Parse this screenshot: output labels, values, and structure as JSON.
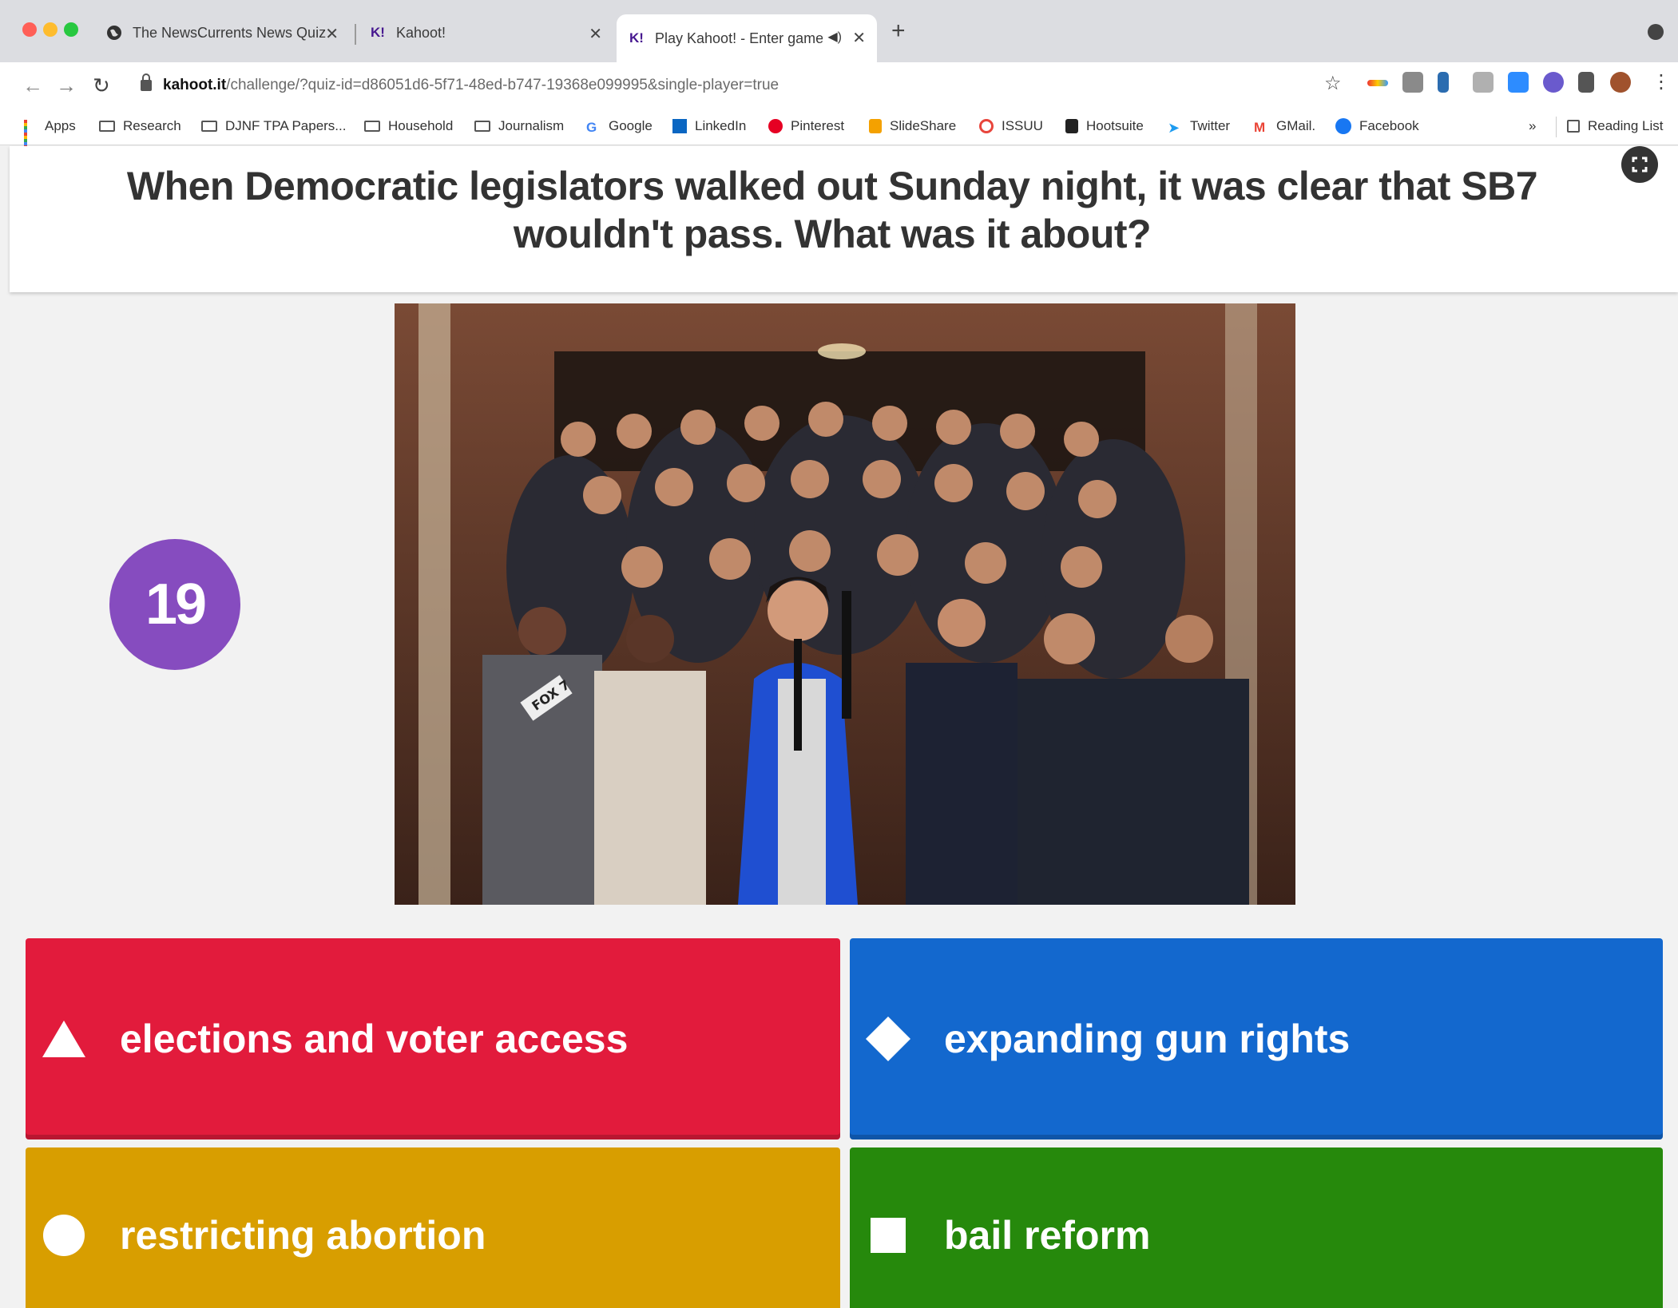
{
  "browser": {
    "tabs": [
      {
        "title": "The NewsCurrents News Quiz",
        "favicon": "globe-icon"
      },
      {
        "title": "Kahoot!",
        "favicon": "K!"
      },
      {
        "title": "Play Kahoot! - Enter game",
        "favicon": "K!"
      }
    ],
    "url_host": "kahoot.it",
    "url_path": "/challenge/?quiz-id=d86051d6-5f71-48ed-b747-19368e099995&single-player=true",
    "bookmarks": [
      {
        "label": "Apps",
        "icon": "apps-grid-icon"
      },
      {
        "label": "Research",
        "icon": "folder-icon"
      },
      {
        "label": "DJNF TPA Papers...",
        "icon": "folder-icon"
      },
      {
        "label": "Household",
        "icon": "folder-icon"
      },
      {
        "label": "Journalism",
        "icon": "folder-icon"
      },
      {
        "label": "Google",
        "icon": "google-icon"
      },
      {
        "label": "LinkedIn",
        "icon": "linkedin-icon"
      },
      {
        "label": "Pinterest",
        "icon": "pinterest-icon"
      },
      {
        "label": "SlideShare",
        "icon": "slideshare-icon"
      },
      {
        "label": "ISSUU",
        "icon": "issuu-icon"
      },
      {
        "label": "Hootsuite",
        "icon": "hootsuite-icon"
      },
      {
        "label": "Twitter",
        "icon": "twitter-icon"
      },
      {
        "label": "GMail.",
        "icon": "gmail-icon"
      },
      {
        "label": "Facebook",
        "icon": "facebook-icon"
      }
    ],
    "overflow_label": "»",
    "reading_list": "Reading List"
  },
  "quiz": {
    "question": "When Democratic legislators walked out Sunday night, it was clear that SB7 wouldn't pass. What was it about?",
    "timer": "19",
    "answers": [
      {
        "label": "elections and voter access",
        "shape": "triangle-icon",
        "color": "#e21b3c"
      },
      {
        "label": "expanding gun rights",
        "shape": "diamond-icon",
        "color": "#1368ce"
      },
      {
        "label": "restricting abortion",
        "shape": "circle-icon",
        "color": "#d89e00"
      },
      {
        "label": "bail reform",
        "shape": "square-icon",
        "color": "#26890c"
      }
    ],
    "photo_mic_text": "FOX 7"
  },
  "colors": {
    "timer": "#864cbf",
    "question_text": "#333333"
  }
}
